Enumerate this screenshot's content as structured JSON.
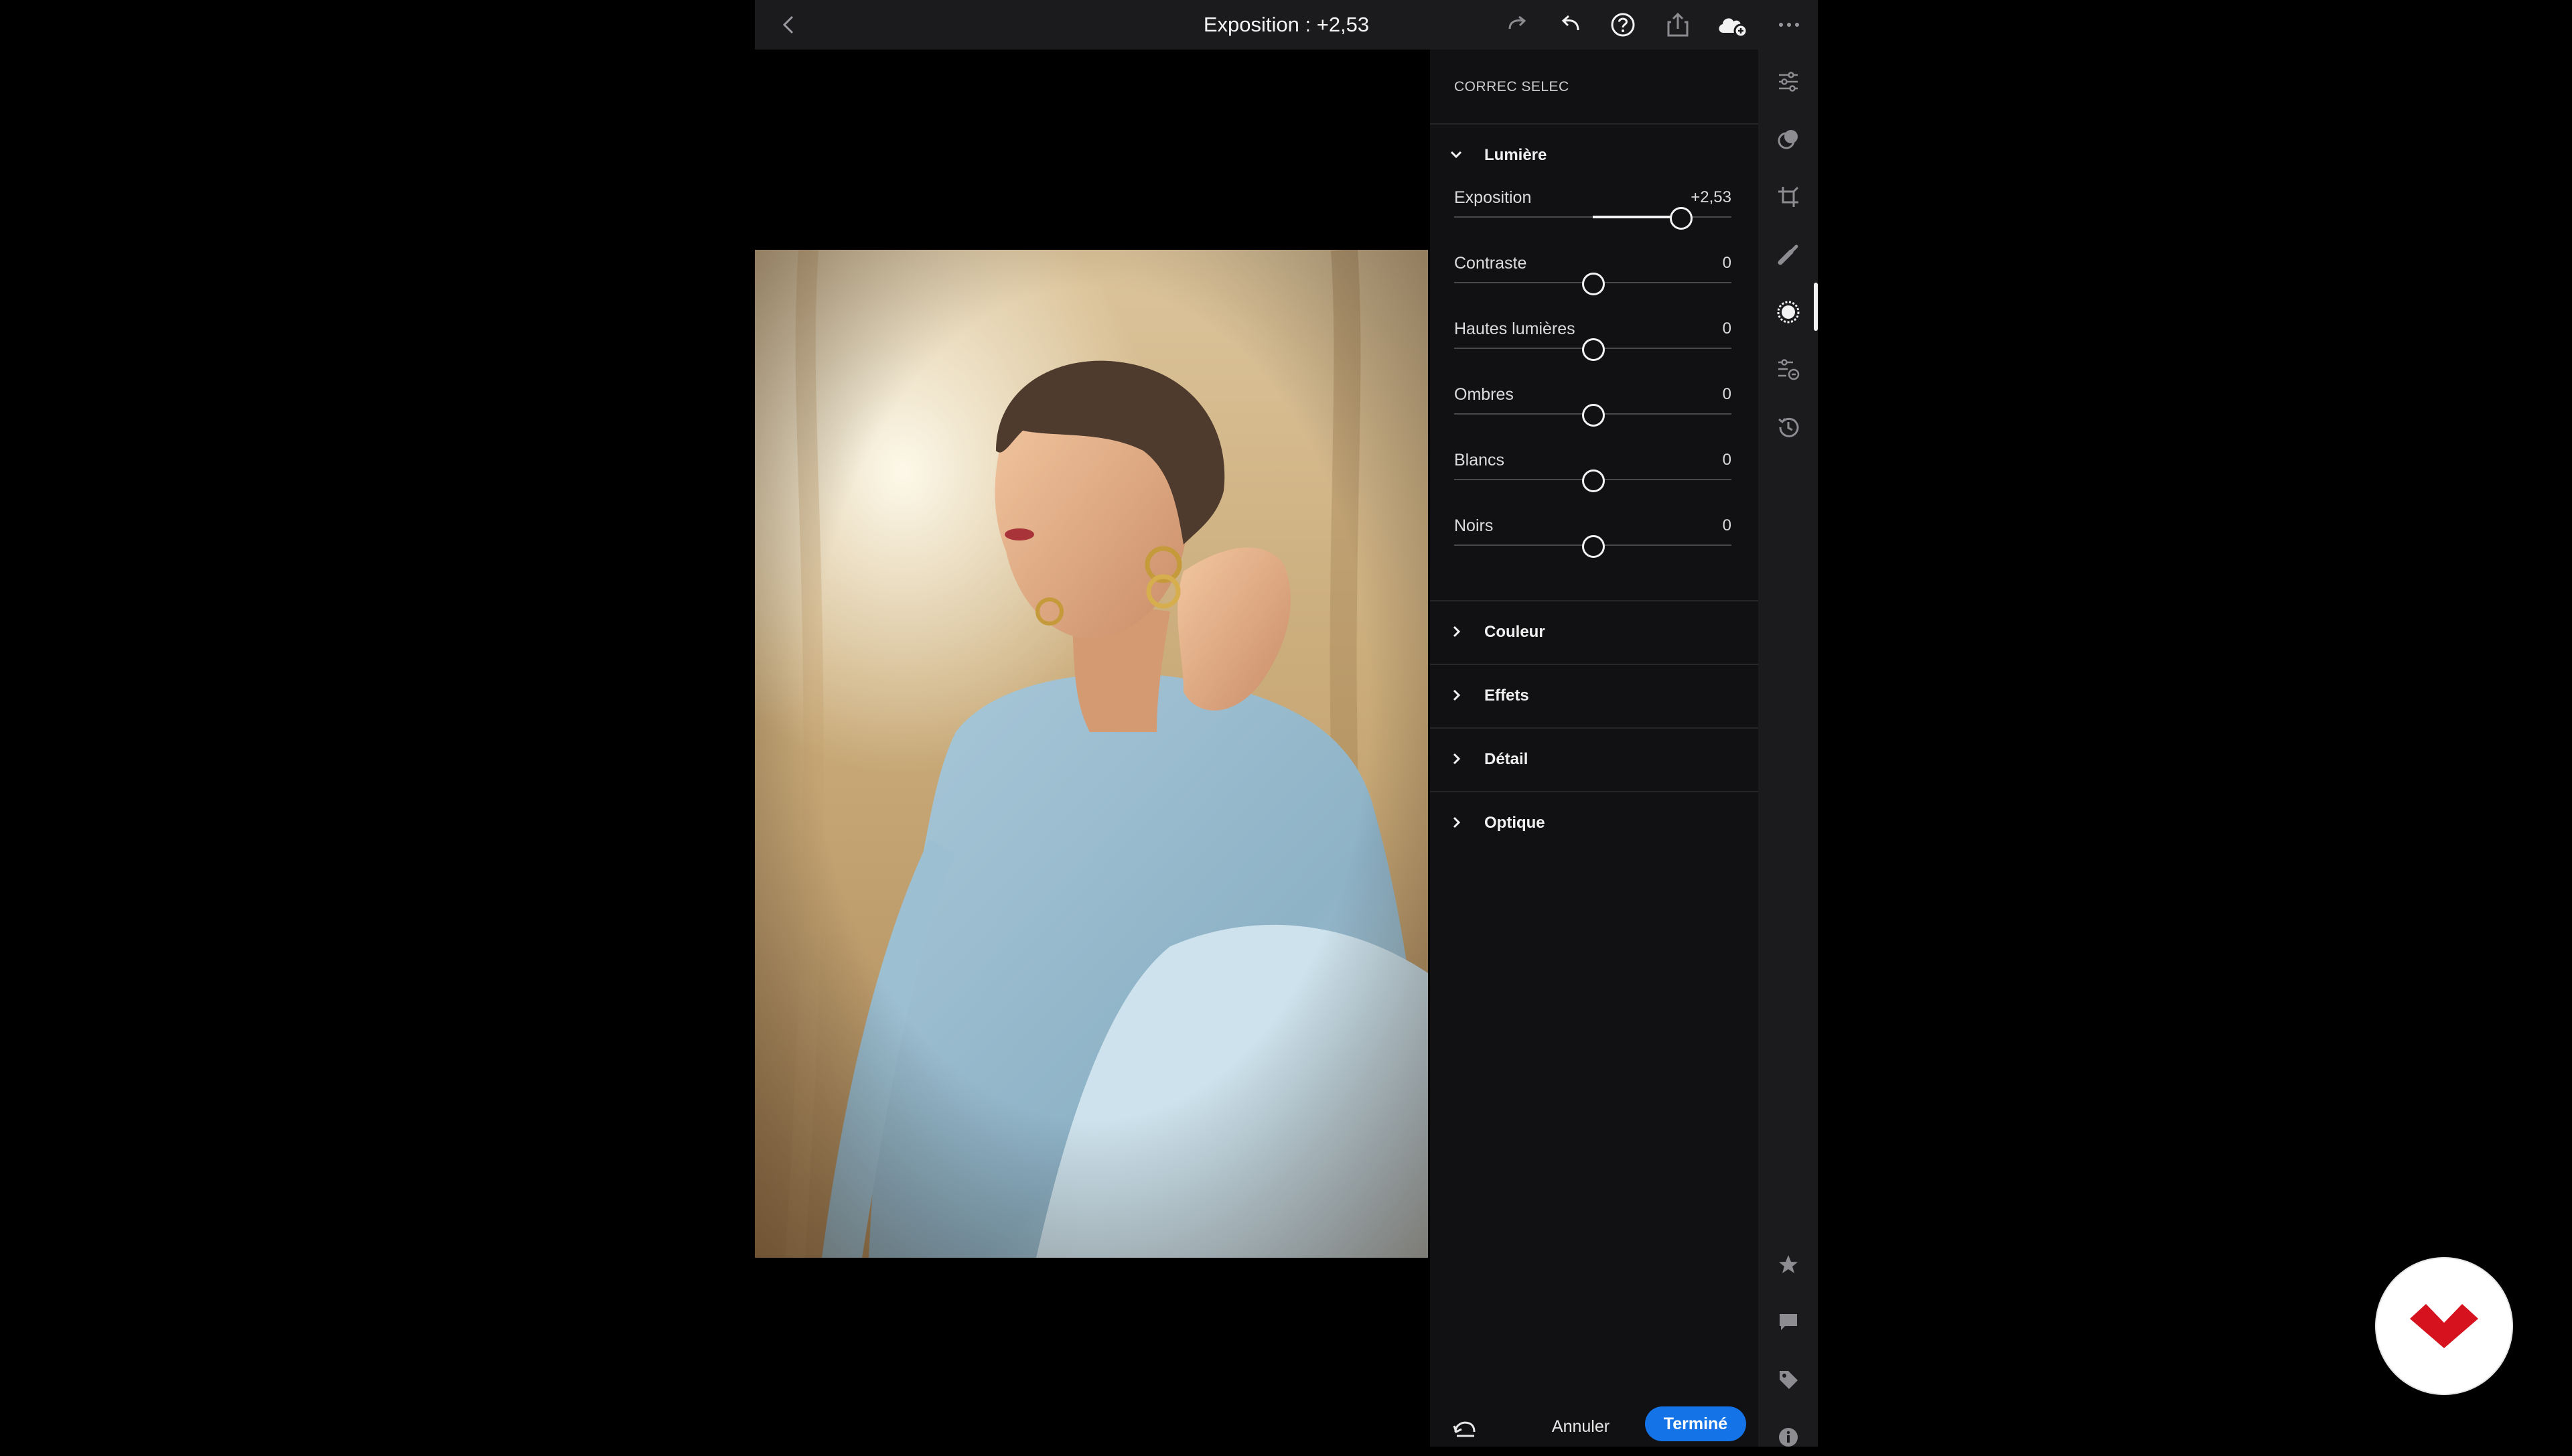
{
  "topbar": {
    "title": "Exposition : +2,53",
    "icons": [
      "back-icon",
      "redo-icon",
      "undo-icon",
      "help-icon",
      "share-icon",
      "cloud-sync-icon",
      "more-icon"
    ]
  },
  "panel": {
    "title": "CORREC SELEC",
    "light_section": {
      "label": "Lumière",
      "expanded": true,
      "sliders": [
        {
          "label": "Exposition",
          "value_text": "+2,53",
          "value": 2.53,
          "min": -4,
          "max": 4
        },
        {
          "label": "Contraste",
          "value_text": "0",
          "value": 0,
          "min": -100,
          "max": 100
        },
        {
          "label": "Hautes lumières",
          "value_text": "0",
          "value": 0,
          "min": -100,
          "max": 100
        },
        {
          "label": "Ombres",
          "value_text": "0",
          "value": 0,
          "min": -100,
          "max": 100
        },
        {
          "label": "Blancs",
          "value_text": "0",
          "value": 0,
          "min": -100,
          "max": 100
        },
        {
          "label": "Noirs",
          "value_text": "0",
          "value": 0,
          "min": -100,
          "max": 100
        }
      ]
    },
    "collapsed_sections": [
      "Couleur",
      "Effets",
      "Détail",
      "Optique"
    ],
    "footer": {
      "cancel_label": "Annuler",
      "done_label": "Terminé"
    }
  },
  "rail": {
    "top_icons": [
      "edit-sliders-icon",
      "presets-icon",
      "crop-icon",
      "healing-brush-icon",
      "masking-icon",
      "versions-icon",
      "history-icon"
    ],
    "active_icon": "masking-icon",
    "bottom_icons": [
      "star-rating-icon",
      "comment-icon",
      "tag-icon",
      "info-icon"
    ]
  },
  "colors": {
    "accent": "#1473e6",
    "panel_bg": "#111113",
    "bar_bg": "#1b1b1d",
    "logo_red": "#d6121f"
  }
}
